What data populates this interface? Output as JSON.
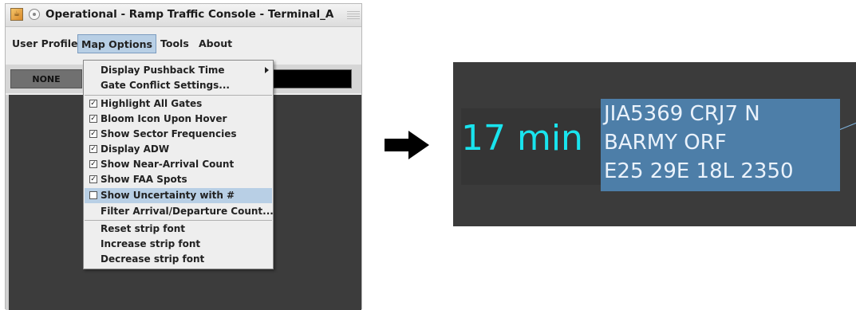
{
  "window": {
    "title": "Operational - Ramp Traffic Console - Terminal_A"
  },
  "menubar": {
    "user_profile": "User Profile",
    "map_options": "Map Options",
    "tools": "Tools",
    "about": "About"
  },
  "toolbar": {
    "none_label": "NONE"
  },
  "dropdown": {
    "display_pushback_time": "Display Pushback Time",
    "gate_conflict_settings": "Gate Conflict Settings...",
    "checkbox_items": [
      {
        "label": "Highlight All Gates",
        "checked": true
      },
      {
        "label": "Bloom Icon Upon Hover",
        "checked": true
      },
      {
        "label": "Show Sector Frequencies",
        "checked": true
      },
      {
        "label": "Display ADW",
        "checked": true
      },
      {
        "label": "Show Near-Arrival Count",
        "checked": true
      },
      {
        "label": "Show FAA Spots",
        "checked": true
      },
      {
        "label": "Show Uncertainty with #",
        "checked": false
      }
    ],
    "filter_arrival_departure": "Filter Arrival/Departure Count...",
    "reset_strip_font": "Reset strip font",
    "increase_strip_font": "Increase strip font",
    "decrease_strip_font": "Decrease strip font"
  },
  "strip": {
    "time": "17 min",
    "line1": "JIA5369 CRJ7 N",
    "line2": "BARMY ORF",
    "line3": "E25 29E 18L 2350"
  },
  "colors": {
    "time_text": "#19e4ee",
    "info_box": "#4d7ea8",
    "panel_bg": "#3b3b3b",
    "menu_highlight": "#b8cfe5"
  }
}
